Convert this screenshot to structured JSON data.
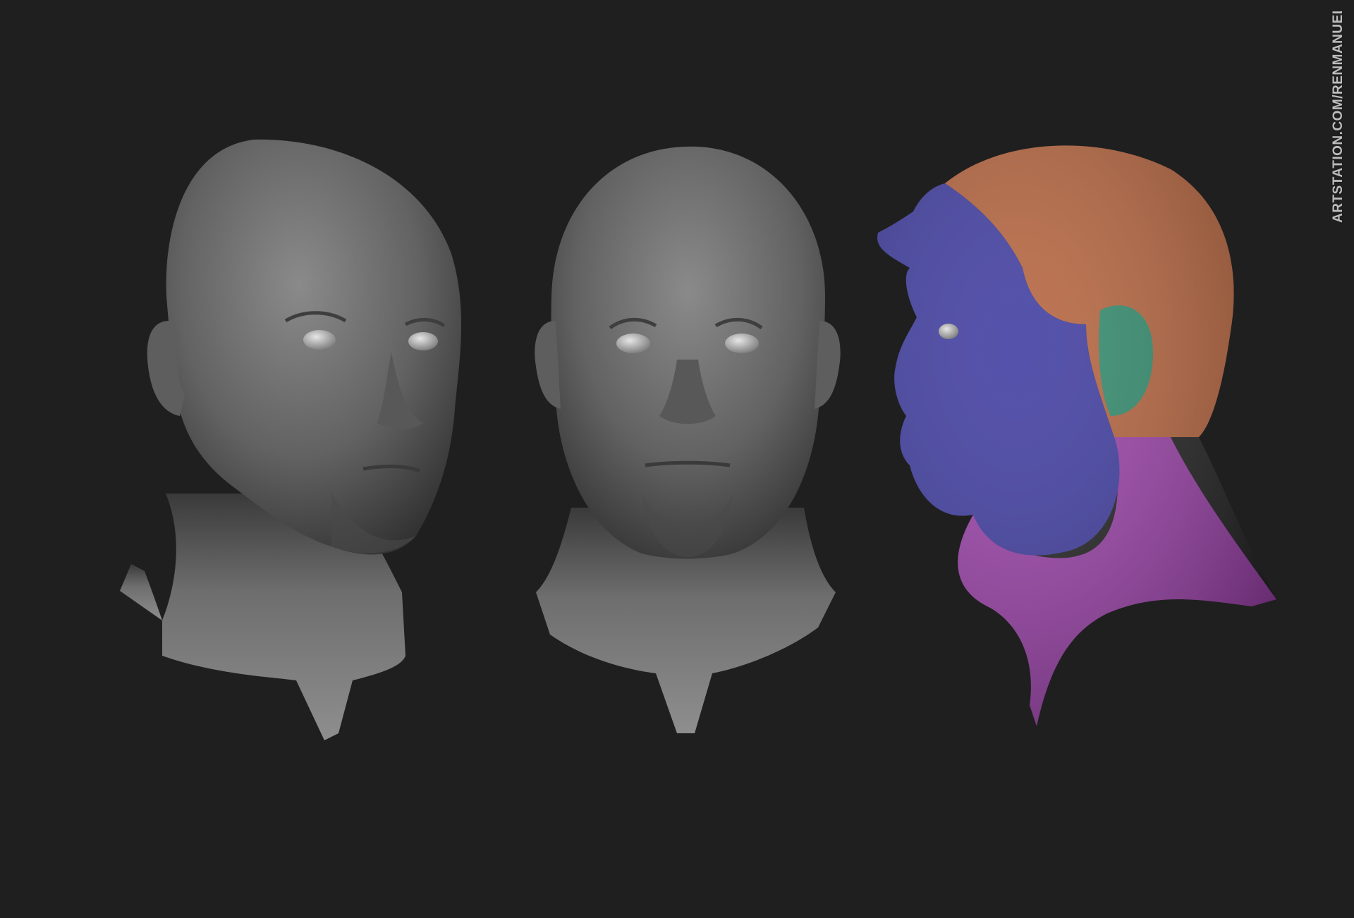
{
  "scene": {
    "background": "#1f1f1f",
    "watermark": "ARTSTATION.COM/RENMANUEL",
    "views": [
      {
        "id": "three-quarter",
        "style": "clay",
        "color": "#6a6a6a"
      },
      {
        "id": "front",
        "style": "clay",
        "color": "#6a6a6a"
      },
      {
        "id": "profile",
        "style": "topology-polygroups"
      }
    ],
    "polygroup_colors": {
      "skull": "#b5623b",
      "face": "#3d3aa0",
      "ear": "#2f8a6b",
      "neck": "#9a3fa8"
    }
  }
}
